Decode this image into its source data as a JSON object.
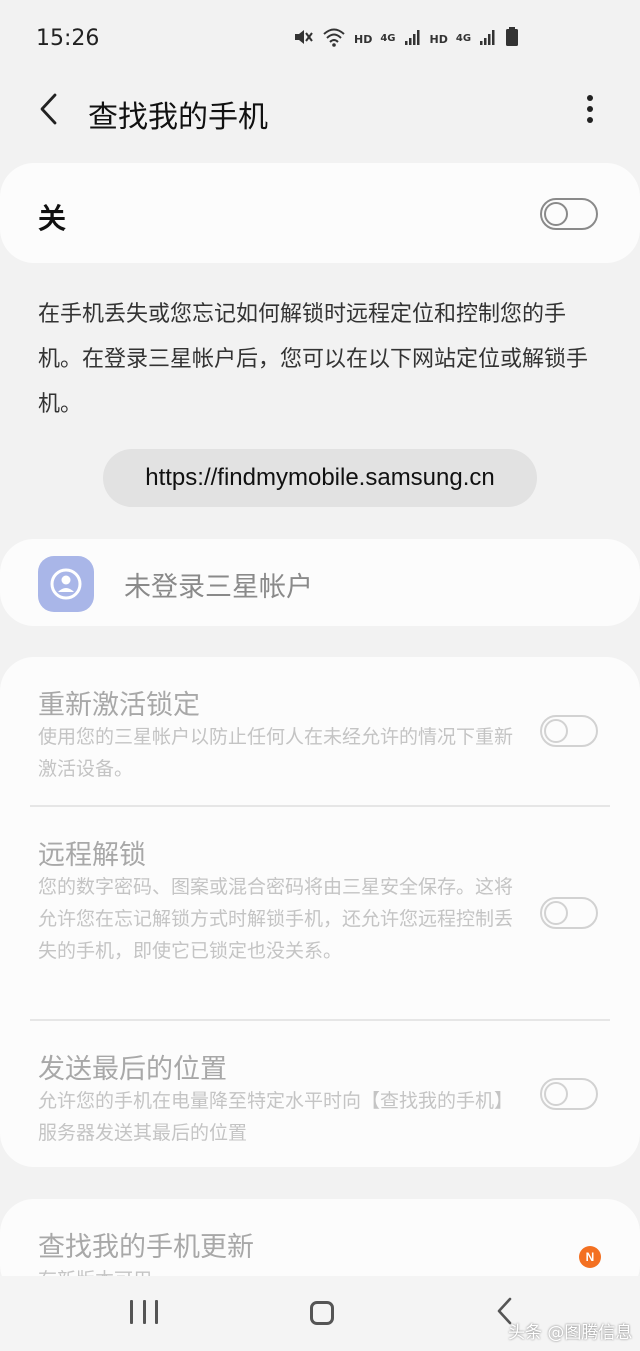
{
  "status_bar": {
    "time": "15:26",
    "hd_1": "HD",
    "net_1": "4G",
    "hd_2": "HD",
    "net_2": "4G",
    "icons": [
      "mute-icon",
      "wifi-icon",
      "signal-icon",
      "signal-icon",
      "battery-icon"
    ]
  },
  "app_bar": {
    "title": "查找我的手机",
    "back_icon": "chevron-left-icon",
    "more_icon": "more-vertical-icon"
  },
  "master_switch": {
    "label": "关",
    "state": "off"
  },
  "description": "在手机丢失或您忘记如何解锁时远程定位和控制您的手机。在登录三星帐户后，您可以在以下网站定位或解锁手机。",
  "url": "https://findmymobile.samsung.cn",
  "account": {
    "label": "未登录三星帐户",
    "icon": "account-icon",
    "icon_color": "#a9b6e8"
  },
  "settings": [
    {
      "title": "重新激活锁定",
      "description": "使用您的三星帐户以防止任何人在未经允许的情况下重新激活设备。",
      "state": "off"
    },
    {
      "title": "远程解锁",
      "description": "您的数字密码、图案或混合密码将由三星安全保存。这将允许您在忘记解锁方式时解锁手机，还允许您远程控制丢失的手机，即使它已锁定也没关系。",
      "state": "off"
    },
    {
      "title": "发送最后的位置",
      "description": "允许您的手机在电量降至特定水平时向【查找我的手机】服务器发送其最后的位置",
      "state": "off"
    }
  ],
  "update": {
    "title": "查找我的手机更新",
    "subtitle": "有新版本可用"
  },
  "notification_badge": "N",
  "nav_bar": {
    "recent_icon": "recent-apps-icon",
    "home_icon": "home-icon",
    "back_icon": "back-icon"
  },
  "watermark": "头条 @图腾信息",
  "colors": {
    "background": "#f2f2f2",
    "card": "#fcfcfc",
    "badge": "#f37021",
    "avatar": "#a9b6e8"
  }
}
